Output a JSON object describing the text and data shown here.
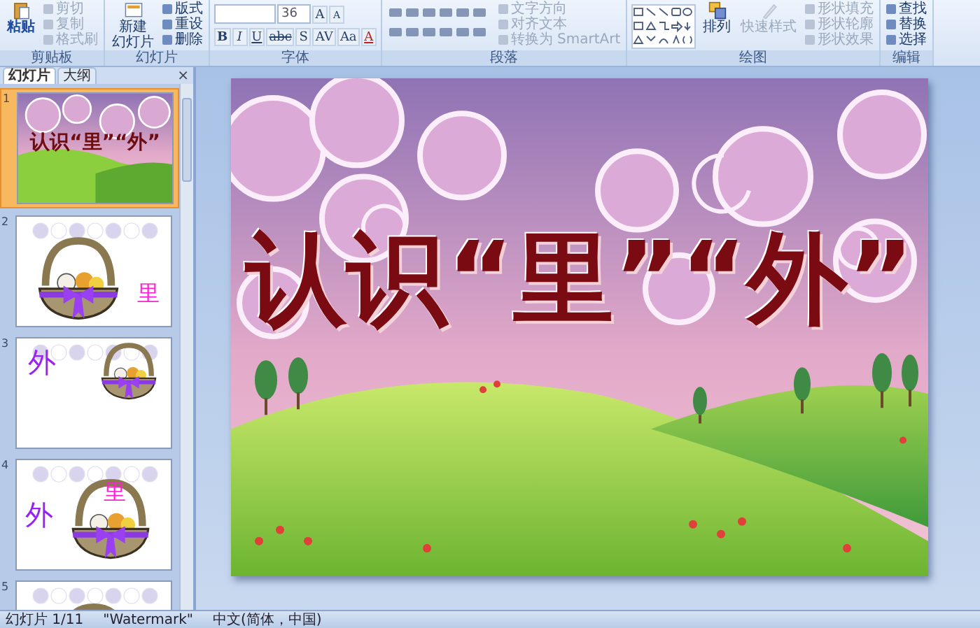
{
  "ribbon": {
    "groups": [
      {
        "kind": "clipboard",
        "label": "剪贴板",
        "paste": "粘贴",
        "actions": [
          {
            "label": "剪切",
            "disabled": true
          },
          {
            "label": "复制",
            "disabled": true
          },
          {
            "label": "格式刷",
            "disabled": true
          }
        ]
      },
      {
        "kind": "slides",
        "label": "幻灯片",
        "new_slide": [
          "新建",
          "幻灯片"
        ],
        "actions": [
          {
            "label": "版式",
            "disabled": false
          },
          {
            "label": "重设",
            "disabled": false
          },
          {
            "label": "删除",
            "disabled": false
          }
        ]
      },
      {
        "kind": "font",
        "label": "字体",
        "size": "36",
        "resize": [
          "A",
          "A"
        ],
        "formats": [
          "B",
          "I",
          "U",
          "abc",
          "S",
          "AV",
          "Aa",
          "A"
        ]
      },
      {
        "kind": "paragraph",
        "label": "段落",
        "actions": [
          {
            "label": "文字方向",
            "disabled": true
          },
          {
            "label": "对齐文本",
            "disabled": true
          },
          {
            "label": "转换为 SmartArt",
            "disabled": true
          }
        ]
      },
      {
        "kind": "drawing",
        "label": "绘图",
        "arrange": "排列",
        "quick_styles": {
          "label": "快速样式",
          "disabled": true
        },
        "actions": [
          {
            "label": "形状填充",
            "disabled": true
          },
          {
            "label": "形状轮廓",
            "disabled": true
          },
          {
            "label": "形状效果",
            "disabled": true
          }
        ]
      },
      {
        "kind": "editing",
        "label": "编辑",
        "actions": [
          {
            "label": "查找",
            "disabled": false
          },
          {
            "label": "替换",
            "disabled": false
          },
          {
            "label": "选择",
            "disabled": false
          }
        ]
      }
    ]
  },
  "panel": {
    "tabs": [
      {
        "label": "幻灯片",
        "selected": true
      },
      {
        "label": "大纲",
        "selected": false
      }
    ],
    "close": "×",
    "slides": [
      {
        "number": "1",
        "selected": true,
        "kind": "title",
        "title": "认识“里”“外”"
      },
      {
        "number": "2",
        "selected": false,
        "kind": "basket-left",
        "labels": [
          {
            "text": "里",
            "color": "#ff1fd0"
          }
        ]
      },
      {
        "number": "3",
        "selected": false,
        "kind": "basket-top",
        "labels": [
          {
            "text": "外",
            "color": "#9a22f0"
          }
        ]
      },
      {
        "number": "4",
        "selected": false,
        "kind": "basket-right",
        "labels": [
          {
            "text": "外",
            "color": "#9a22f0"
          },
          {
            "text": "里",
            "color": "#ff1fd0"
          }
        ]
      },
      {
        "number": "5",
        "selected": false,
        "kind": "basket-center"
      }
    ]
  },
  "slide": {
    "title": "认识“里”“外”"
  },
  "status_bar": [
    "幻灯片 1/11",
    "\"Watermark\"",
    "中文(简体，中国)"
  ]
}
